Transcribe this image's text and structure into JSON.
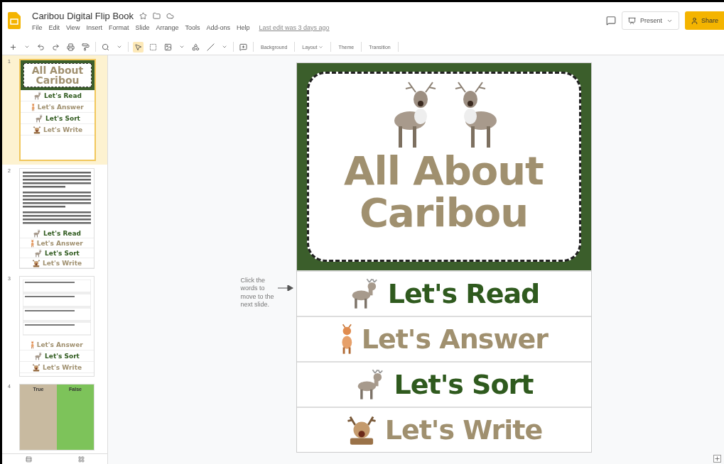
{
  "app": {
    "title": "Caribou Digital Flip Book",
    "menu": [
      "File",
      "Edit",
      "View",
      "Insert",
      "Format",
      "Slide",
      "Arrange",
      "Tools",
      "Add-ons",
      "Help"
    ],
    "last_edit": "Last edit was 3 days ago",
    "present": "Present",
    "share": "Share"
  },
  "toolbar": {
    "buttons": [
      {
        "label": "Background",
        "kind": "plain"
      },
      {
        "label": "Layout",
        "kind": "menu"
      },
      {
        "label": "Theme",
        "kind": "plain"
      },
      {
        "label": "Transition",
        "kind": "plain"
      }
    ]
  },
  "filmstrip": [
    {
      "number": "1",
      "selected": true,
      "kind": "title",
      "title_lines": [
        "All About",
        "Caribou"
      ],
      "links": [
        {
          "label": "Let's Read",
          "color": "#2f5a1e",
          "kind": "standing"
        },
        {
          "label": "Let's Answer",
          "color": "#a0906f",
          "kind": "fawn"
        },
        {
          "label": "Let's Sort",
          "color": "#2f5a1e",
          "kind": "standing"
        },
        {
          "label": "Let's Write",
          "color": "#a0906f",
          "kind": "face"
        }
      ]
    },
    {
      "number": "2",
      "selected": false,
      "kind": "reading",
      "links": [
        {
          "label": "Let's Read",
          "color": "#2f5a1e",
          "kind": "standing"
        },
        {
          "label": "Let's Answer",
          "color": "#a0906f",
          "kind": "fawn"
        },
        {
          "label": "Let's Sort",
          "color": "#2f5a1e",
          "kind": "standing"
        },
        {
          "label": "Let's Write",
          "color": "#a0906f",
          "kind": "face"
        }
      ]
    },
    {
      "number": "3",
      "selected": false,
      "kind": "questions",
      "links": [
        {
          "label": "Let's Answer",
          "color": "#a0906f",
          "kind": "fawn"
        },
        {
          "label": "Let's Sort",
          "color": "#2f5a1e",
          "kind": "standing"
        },
        {
          "label": "Let's Write",
          "color": "#a0906f",
          "kind": "face"
        }
      ]
    },
    {
      "number": "4",
      "selected": false,
      "kind": "sort",
      "columns": [
        {
          "label": "True",
          "color": "#c8baa0"
        },
        {
          "label": "False",
          "color": "#7dc35a"
        }
      ]
    }
  ],
  "slide": {
    "title_lines": [
      "All About",
      "Caribou"
    ],
    "note": "Click the words to move to the next slide.",
    "links": [
      {
        "label": "Let's Read",
        "color": "#2f5a1e",
        "kind": "standing"
      },
      {
        "label": "Let's Answer",
        "color": "#a0906f",
        "kind": "fawn"
      },
      {
        "label": "Let's Sort",
        "color": "#2f5a1e",
        "kind": "standing"
      },
      {
        "label": "Let's Write",
        "color": "#a0906f",
        "kind": "face"
      }
    ]
  }
}
